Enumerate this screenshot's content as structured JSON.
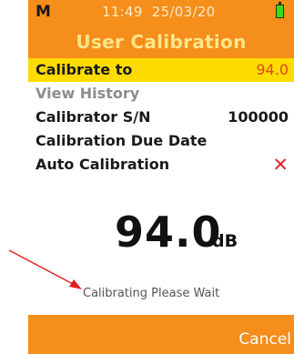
{
  "status_bar": {
    "mode": "M",
    "time": "11:49",
    "date": "25/03/20",
    "battery_icon": "battery-full-icon"
  },
  "screen_title": "User Calibration",
  "menu": {
    "calibrate_to": {
      "label": "Calibrate to",
      "value": "94.0"
    },
    "view_history": {
      "label": "View History"
    },
    "calibrator_sn": {
      "label": "Calibrator S/N",
      "value": "100000"
    },
    "due_date": {
      "label": "Calibration Due Date"
    },
    "auto_calibration": {
      "label": "Auto Calibration",
      "value": "✕",
      "icon": "cross-icon"
    }
  },
  "reading": {
    "level": "94.0",
    "unit": "dB"
  },
  "status_message": "Calibrating Please Wait",
  "softkey": {
    "cancel_label": "Cancel"
  },
  "colors": {
    "accent_orange": "#f58e1a",
    "selected_row": "#ffdc00",
    "value_red": "#e04616",
    "cross_red": "#e6252b",
    "arrow_red": "#e02020"
  }
}
